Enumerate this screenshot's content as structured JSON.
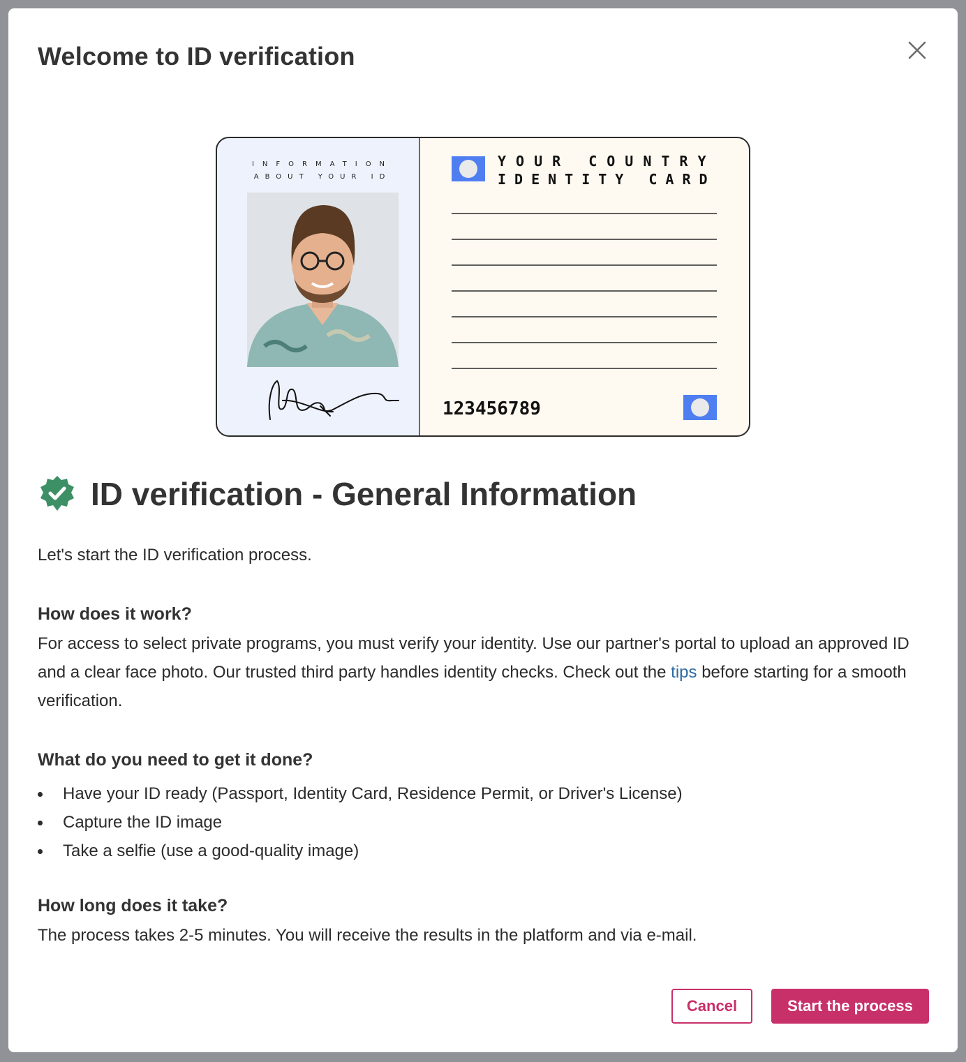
{
  "colors": {
    "accent": "#c8306a",
    "link": "#2d6aa3",
    "badge": "#3d8f66",
    "card_blue": "#4f7ef1",
    "card_left_bg": "#eef2fc",
    "card_right_bg": "#fffaf1"
  },
  "modal": {
    "title": "Welcome to ID verification",
    "close_icon": "close-icon"
  },
  "card": {
    "left_line1": "INFORMATION",
    "left_line2": "ABOUT YOUR ID",
    "right_line1": "YOUR COUNTRY",
    "right_line2": "IDENTITY CARD",
    "number": "123456789",
    "photo_icon": "person-photo",
    "signature_icon": "signature"
  },
  "content": {
    "badge_icon": "verified-badge-icon",
    "heading": "ID verification - General Information",
    "intro": "Let's start the ID verification process.",
    "how_title": "How does it work?",
    "how_text_before": "For access to select private programs, you must verify your identity. Use our partner's portal to upload an approved ID and a clear face photo. Our trusted third party handles identity checks. Check out the ",
    "how_link": "tips",
    "how_text_after": " before starting for a smooth verification.",
    "need_title": "What do you need to get it done?",
    "need_items": [
      "Have your ID ready (Passport, Identity Card, Residence Permit, or Driver's License)",
      "Capture the ID image",
      "Take a selfie (use a good-quality image)"
    ],
    "long_title": "How long does it take?",
    "long_text": "The process takes 2-5 minutes. You will receive the results in the platform and via e-mail."
  },
  "buttons": {
    "cancel": "Cancel",
    "start": "Start the process"
  }
}
